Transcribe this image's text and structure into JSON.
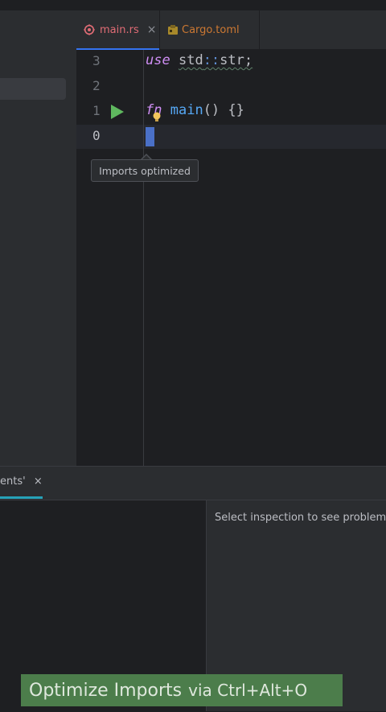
{
  "tabs": [
    {
      "label": "main.rs",
      "color": "#e06c75",
      "icon": "rust-icon",
      "active": true
    },
    {
      "label": "Cargo.toml",
      "color": "#cc7832",
      "icon": "cargo-icon",
      "active": false
    }
  ],
  "editor": {
    "lines": [
      {
        "number": "3"
      },
      {
        "number": "2"
      },
      {
        "number": "1"
      },
      {
        "number": "0"
      }
    ],
    "code": {
      "use_kw": "use",
      "path_a": "std",
      "path_sep": "::",
      "path_b": "str;",
      "fn_kw": "fn",
      "fn_name": "main",
      "fn_rest": "() {}"
    },
    "run_gutter_icon": "run-icon",
    "intention_icon": "lightbulb-icon"
  },
  "tooltip": {
    "text": "Imports optimized"
  },
  "problems": {
    "tab_label": "ents'",
    "close_glyph": "×",
    "hint": "Select inspection to see problems"
  },
  "banner": {
    "action": "Optimize Imports",
    "shortcut": "via Ctrl+Alt+O"
  },
  "colors": {
    "accent": "#3574f0",
    "run_green": "#5fb85f",
    "banner_bg": "#4c7d4b"
  }
}
